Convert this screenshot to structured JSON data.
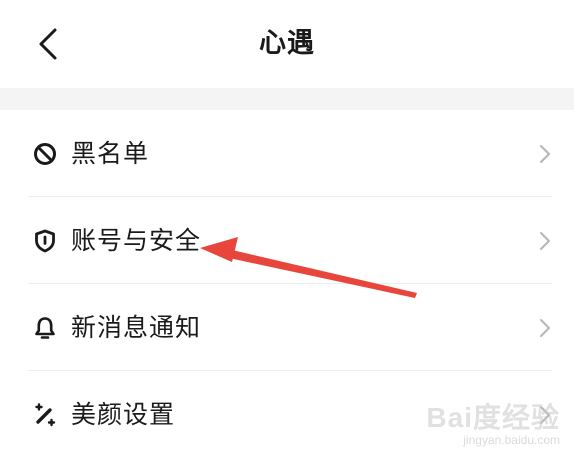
{
  "header": {
    "title": "心遇",
    "back_icon": "chevron-left-icon"
  },
  "settings": {
    "items": [
      {
        "label": "黑名单",
        "icon": "block-icon"
      },
      {
        "label": "账号与安全",
        "icon": "shield-icon"
      },
      {
        "label": "新消息通知",
        "icon": "bell-icon"
      },
      {
        "label": "美颜设置",
        "icon": "beauty-wand-icon"
      }
    ]
  },
  "annotation": {
    "arrow_color": "#e8453c",
    "target": "账号与安全"
  },
  "watermark": {
    "brand": "Bai度经验",
    "url": "jingyan.baidu.com"
  },
  "colors": {
    "text": "#1a1a1a",
    "chevron": "#b5b5b5",
    "band": "#f4f4f4"
  }
}
